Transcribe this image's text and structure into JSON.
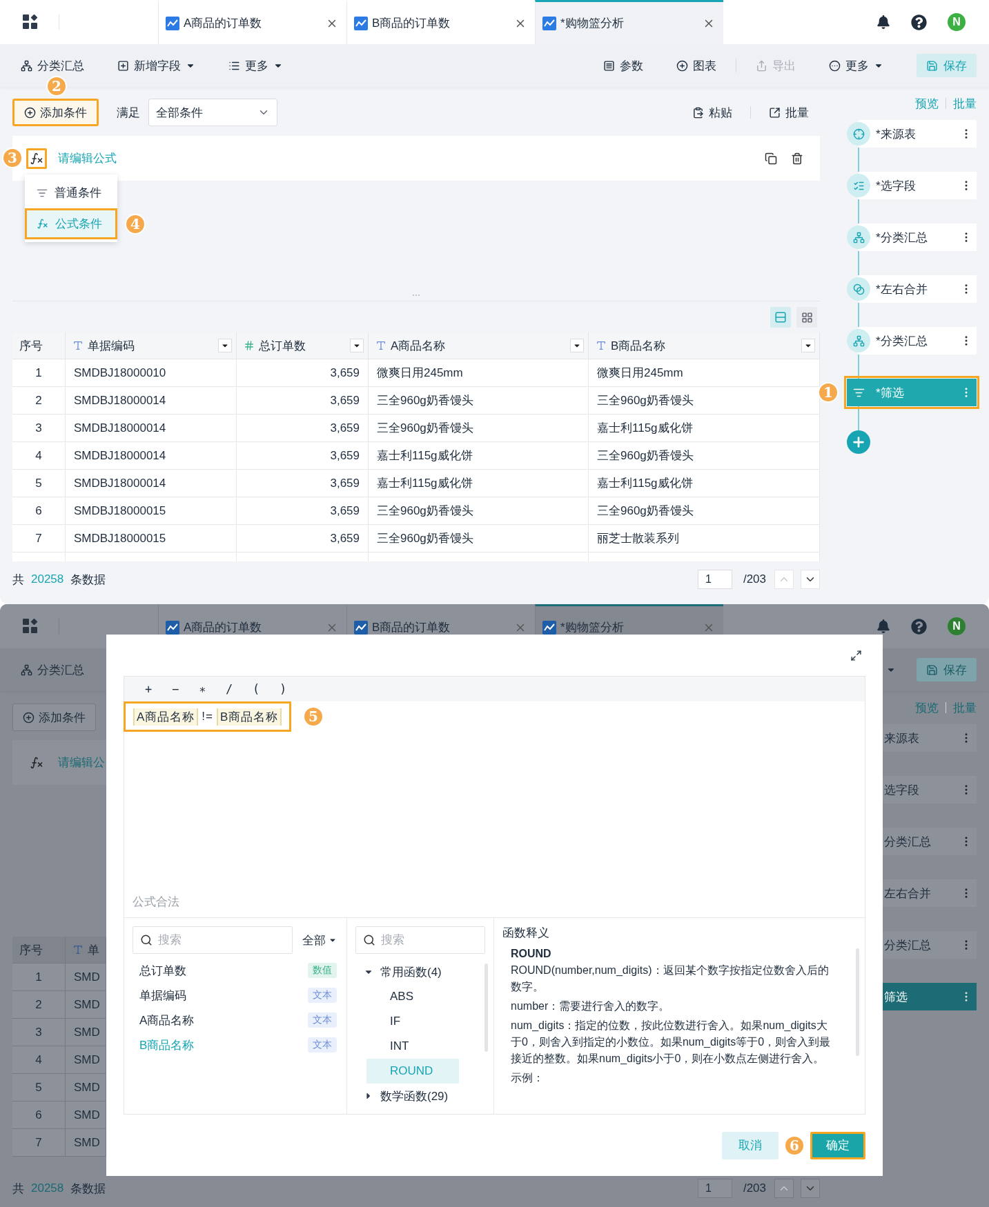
{
  "main_window": {
    "tabs": [
      {
        "label": "A商品的订单数",
        "selected": false
      },
      {
        "label": "B商品的订单数",
        "selected": false
      },
      {
        "label": "*购物篮分析",
        "selected": true
      }
    ],
    "avatar": "N",
    "toolbar_left": [
      {
        "label": "分类汇总",
        "kind": "plain"
      },
      {
        "label": "新增字段",
        "kind": "menu"
      },
      {
        "label": "更多",
        "kind": "menu"
      }
    ],
    "toolbar_right": [
      {
        "label": "参数",
        "kind": "plain",
        "disabled": false
      },
      {
        "label": "图表",
        "kind": "plain",
        "disabled": false
      },
      {
        "label": "导出",
        "kind": "plain",
        "disabled": true
      },
      {
        "label": "更多",
        "kind": "menu",
        "disabled": false
      },
      {
        "label": "保存",
        "kind": "primary",
        "disabled": false
      }
    ],
    "condition_bar": {
      "add_button": {
        "label": "添加条件",
        "annotation": "2"
      },
      "match_label": "满足",
      "match_select": "全部条件",
      "actions": [
        "粘贴",
        "批量"
      ]
    },
    "formula_row": {
      "annotation": "3",
      "link": "请编辑公式"
    },
    "condition_menu": [
      {
        "label": "普通条件",
        "selected": false
      },
      {
        "label": "公式条件",
        "selected": true,
        "annotation": "4"
      }
    ],
    "table": {
      "columns": [
        {
          "label": "序号",
          "kind": "index"
        },
        {
          "label": "单据编码",
          "kind": "text"
        },
        {
          "label": "总订单数",
          "kind": "number"
        },
        {
          "label": "A商品名称",
          "kind": "text"
        },
        {
          "label": "B商品名称",
          "kind": "text"
        }
      ],
      "rows": [
        [
          "1",
          "SMDBJ18000010",
          "3,659",
          "微爽日用245mm",
          "微爽日用245mm"
        ],
        [
          "2",
          "SMDBJ18000014",
          "3,659",
          "三全960g奶香馒头",
          "三全960g奶香馒头"
        ],
        [
          "3",
          "SMDBJ18000014",
          "3,659",
          "三全960g奶香馒头",
          "嘉士利115g威化饼"
        ],
        [
          "4",
          "SMDBJ18000014",
          "3,659",
          "嘉士利115g威化饼",
          "三全960g奶香馒头"
        ],
        [
          "5",
          "SMDBJ18000014",
          "3,659",
          "嘉士利115g威化饼",
          "嘉士利115g威化饼"
        ],
        [
          "6",
          "SMDBJ18000015",
          "3,659",
          "三全960g奶香馒头",
          "三全960g奶香馒头"
        ],
        [
          "7",
          "SMDBJ18000015",
          "3,659",
          "三全960g奶香馒头",
          "丽芝士散装系列"
        ]
      ]
    },
    "footer": {
      "prefix": "共",
      "count": "20258",
      "suffix": "条数据",
      "page": "1",
      "pages": "/203"
    },
    "sidebar": {
      "links": [
        "预览",
        "批量"
      ],
      "steps": [
        {
          "label": "*来源表",
          "selected": false
        },
        {
          "label": "*选字段",
          "selected": false
        },
        {
          "label": "*分类汇总",
          "selected": false
        },
        {
          "label": "*左右合并",
          "selected": false
        },
        {
          "label": "*分类汇总",
          "selected": false
        },
        {
          "label": "*筛选",
          "selected": true,
          "annotation": "1"
        }
      ]
    }
  },
  "formula_dialog_screen": {
    "background": {
      "tabs": [
        {
          "label": "A商品的订单数",
          "selected": false
        },
        {
          "label": "B商品的订单数",
          "selected": false
        },
        {
          "label": "*购物篮分析",
          "selected": true
        }
      ],
      "avatar": "N",
      "toolbar_item": "分类汇总",
      "save": "保存",
      "add_button": "添加条件",
      "formula_link": "请编辑公",
      "sidebar_links": [
        "预览",
        "批量"
      ],
      "steps": [
        {
          "label": "来源表",
          "selected": false
        },
        {
          "label": "选字段",
          "selected": false
        },
        {
          "label": "分类汇总",
          "selected": false
        },
        {
          "label": "左右合并",
          "selected": false
        },
        {
          "label": "分类汇总",
          "selected": false
        },
        {
          "label": "筛选",
          "selected": true
        }
      ],
      "table": {
        "columns": [
          {
            "label": "序号",
            "kind": "index"
          },
          {
            "label": "单",
            "kind": "text"
          }
        ],
        "rows": [
          [
            "1",
            "SMD"
          ],
          [
            "2",
            "SMD"
          ],
          [
            "3",
            "SMD"
          ],
          [
            "4",
            "SMD"
          ],
          [
            "5",
            "SMD"
          ],
          [
            "6",
            "SMD"
          ],
          [
            "7",
            "SMD"
          ]
        ]
      },
      "footer": {
        "prefix": "共",
        "count": "20258",
        "suffix": "条数据",
        "page": "1",
        "pages": "/203"
      }
    },
    "dialog": {
      "operators": [
        "+",
        "−",
        "∗",
        "/",
        "(",
        ")"
      ],
      "formula": {
        "annotation": "5",
        "tokens": [
          {
            "kind": "field",
            "text": "A商品名称"
          },
          {
            "kind": "operator",
            "text": "!="
          },
          {
            "kind": "field",
            "text": "B商品名称"
          }
        ]
      },
      "status": "公式合法",
      "fields_pane": {
        "search_placeholder": "搜索",
        "filter": "全部",
        "fields": [
          {
            "name": "总订单数",
            "type": "数值",
            "kind": "number",
            "selected": false
          },
          {
            "name": "单据编码",
            "type": "文本",
            "kind": "text",
            "selected": false
          },
          {
            "name": "A商品名称",
            "type": "文本",
            "kind": "text",
            "selected": false
          },
          {
            "name": "B商品名称",
            "type": "文本",
            "kind": "text",
            "selected": true
          }
        ]
      },
      "functions_pane": {
        "search_placeholder": "搜索",
        "groups": [
          {
            "label": "常用函数(4)",
            "expanded": true,
            "children": [
              {
                "label": "ABS",
                "selected": false
              },
              {
                "label": "IF",
                "selected": false
              },
              {
                "label": "INT",
                "selected": false
              },
              {
                "label": "ROUND",
                "selected": true
              }
            ]
          },
          {
            "label": "数学函数(29)",
            "expanded": false
          }
        ]
      },
      "help": {
        "title": "函数释义",
        "name": "ROUND",
        "paragraphs": [
          "ROUND(number,num_digits)：返回某个数字按指定位数舍入后的数字。",
          "number：需要进行舍入的数字。",
          "num_digits：指定的位数，按此位数进行舍入。如果num_digits大于0，则舍入到指定的小数位。如果num_digits等于0，则舍入到最接近的整数。如果num_digits小于0，则在小数点左侧进行舍入。",
          "示例："
        ]
      },
      "buttons": [
        {
          "label": "取消",
          "kind": "secondary"
        },
        {
          "label": "确定",
          "kind": "primary",
          "annotation": "6"
        }
      ]
    }
  }
}
